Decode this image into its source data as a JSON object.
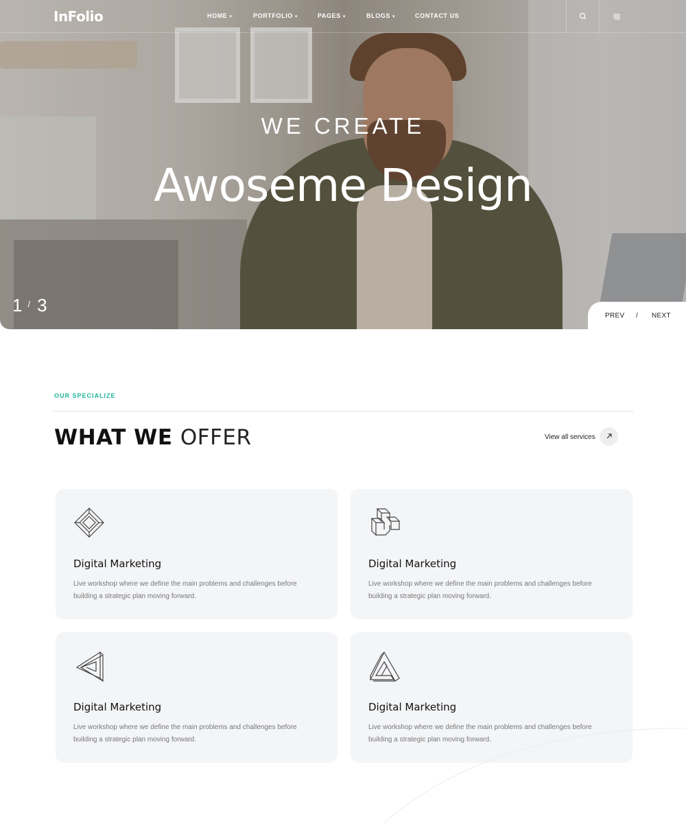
{
  "nav": {
    "logo": "InFolio",
    "items": [
      {
        "label": "HOME"
      },
      {
        "label": "PORTFOLIO"
      },
      {
        "label": "PAGES"
      },
      {
        "label": "BLOGS"
      },
      {
        "label": "CONTACT US"
      }
    ],
    "search_icon": "search-icon",
    "menu_icon": "menu-icon"
  },
  "hero": {
    "subtitle": "WE CREATE",
    "title": "Awoseme Design",
    "slide_current": "1",
    "slide_total": "3",
    "prev_label": "PREV",
    "next_label": "NEXT"
  },
  "offer": {
    "tag": "OUR SPECIALIZE",
    "title_bold": "WHAT WE",
    "title_light": "OFFER",
    "view_all": "View all services",
    "cards": [
      {
        "icon": "cube-frame-icon",
        "title": "Digital Marketing",
        "desc": "Live workshop where we define the main problems and challenges before building a strategic plan moving forward."
      },
      {
        "icon": "interlocked-cube-icon",
        "title": "Digital Marketing",
        "desc": "Live workshop where we define the main problems and challenges before building a strategic plan moving forward."
      },
      {
        "icon": "impossible-triangle-icon",
        "title": "Digital Marketing",
        "desc": "Live workshop where we define the main problems and challenges before building a strategic plan moving forward."
      },
      {
        "icon": "penrose-triangle-icon",
        "title": "Digital Marketing",
        "desc": "Live workshop where we define the main problems and challenges before building a strategic plan moving forward."
      }
    ]
  },
  "colors": {
    "accent": "#1db597",
    "card_bg": "#f4f5f7"
  }
}
